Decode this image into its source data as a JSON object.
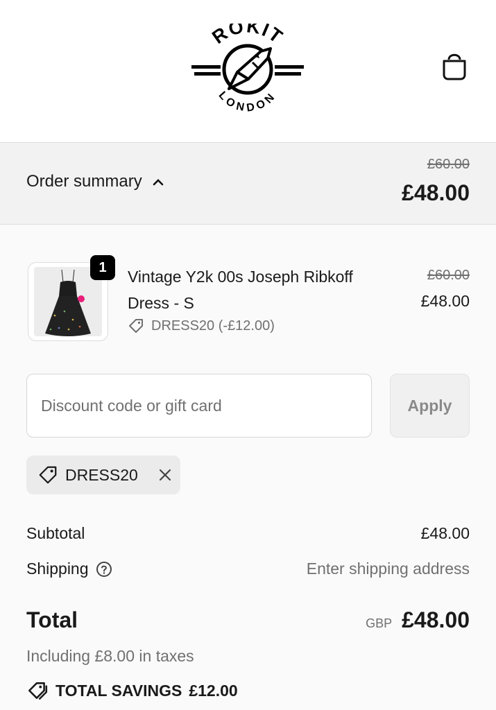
{
  "brand": {
    "logo_top_text": "ROKIT",
    "logo_bottom_text": "LONDON"
  },
  "header": {
    "cart_icon": "shopping-bag-icon"
  },
  "order_summary": {
    "toggle_label": "Order summary",
    "toggle_icon": "chevron-up-icon",
    "original_price": "£60.00",
    "total_price": "£48.00"
  },
  "line_item": {
    "quantity": "1",
    "name": "Vintage Y2k 00s Joseph Ribkoff Dress - S",
    "discount": "DRESS20 (-£12.00)",
    "original_price": "£60.00",
    "price": "£48.00"
  },
  "discount_form": {
    "placeholder": "Discount code or gift card",
    "value": "",
    "apply_label": "Apply"
  },
  "applied_code": {
    "code": "DRESS20",
    "remove_icon": "close-icon"
  },
  "totals": {
    "subtotal_label": "Subtotal",
    "subtotal_value": "£48.00",
    "shipping_label": "Shipping",
    "shipping_value": "Enter shipping address",
    "total_label": "Total",
    "currency": "GBP",
    "total_value": "£48.00",
    "taxes_note": "Including £8.00 in taxes",
    "savings_label": "TOTAL SAVINGS",
    "savings_value": "£12.00"
  },
  "colors": {
    "accent": "#000000",
    "muted_text": "#707070",
    "panel_bg": "#f2f2f2",
    "dress_accent": "#e8207a"
  }
}
